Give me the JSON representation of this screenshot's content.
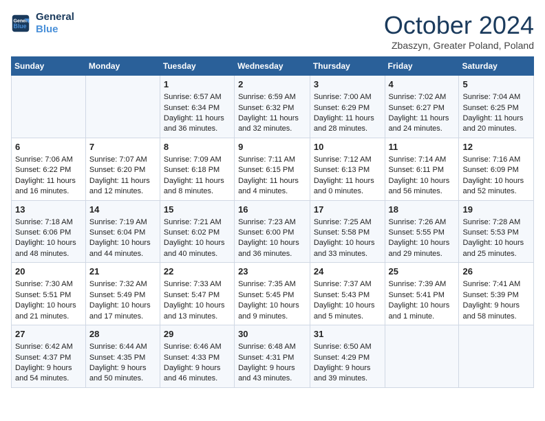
{
  "header": {
    "logo_line1": "General",
    "logo_line2": "Blue",
    "month_title": "October 2024",
    "subtitle": "Zbaszyn, Greater Poland, Poland"
  },
  "days_of_week": [
    "Sunday",
    "Monday",
    "Tuesday",
    "Wednesday",
    "Thursday",
    "Friday",
    "Saturday"
  ],
  "weeks": [
    [
      {
        "day": "",
        "sunrise": "",
        "sunset": "",
        "daylight": ""
      },
      {
        "day": "",
        "sunrise": "",
        "sunset": "",
        "daylight": ""
      },
      {
        "day": "1",
        "sunrise": "Sunrise: 6:57 AM",
        "sunset": "Sunset: 6:34 PM",
        "daylight": "Daylight: 11 hours and 36 minutes."
      },
      {
        "day": "2",
        "sunrise": "Sunrise: 6:59 AM",
        "sunset": "Sunset: 6:32 PM",
        "daylight": "Daylight: 11 hours and 32 minutes."
      },
      {
        "day": "3",
        "sunrise": "Sunrise: 7:00 AM",
        "sunset": "Sunset: 6:29 PM",
        "daylight": "Daylight: 11 hours and 28 minutes."
      },
      {
        "day": "4",
        "sunrise": "Sunrise: 7:02 AM",
        "sunset": "Sunset: 6:27 PM",
        "daylight": "Daylight: 11 hours and 24 minutes."
      },
      {
        "day": "5",
        "sunrise": "Sunrise: 7:04 AM",
        "sunset": "Sunset: 6:25 PM",
        "daylight": "Daylight: 11 hours and 20 minutes."
      }
    ],
    [
      {
        "day": "6",
        "sunrise": "Sunrise: 7:06 AM",
        "sunset": "Sunset: 6:22 PM",
        "daylight": "Daylight: 11 hours and 16 minutes."
      },
      {
        "day": "7",
        "sunrise": "Sunrise: 7:07 AM",
        "sunset": "Sunset: 6:20 PM",
        "daylight": "Daylight: 11 hours and 12 minutes."
      },
      {
        "day": "8",
        "sunrise": "Sunrise: 7:09 AM",
        "sunset": "Sunset: 6:18 PM",
        "daylight": "Daylight: 11 hours and 8 minutes."
      },
      {
        "day": "9",
        "sunrise": "Sunrise: 7:11 AM",
        "sunset": "Sunset: 6:15 PM",
        "daylight": "Daylight: 11 hours and 4 minutes."
      },
      {
        "day": "10",
        "sunrise": "Sunrise: 7:12 AM",
        "sunset": "Sunset: 6:13 PM",
        "daylight": "Daylight: 11 hours and 0 minutes."
      },
      {
        "day": "11",
        "sunrise": "Sunrise: 7:14 AM",
        "sunset": "Sunset: 6:11 PM",
        "daylight": "Daylight: 10 hours and 56 minutes."
      },
      {
        "day": "12",
        "sunrise": "Sunrise: 7:16 AM",
        "sunset": "Sunset: 6:09 PM",
        "daylight": "Daylight: 10 hours and 52 minutes."
      }
    ],
    [
      {
        "day": "13",
        "sunrise": "Sunrise: 7:18 AM",
        "sunset": "Sunset: 6:06 PM",
        "daylight": "Daylight: 10 hours and 48 minutes."
      },
      {
        "day": "14",
        "sunrise": "Sunrise: 7:19 AM",
        "sunset": "Sunset: 6:04 PM",
        "daylight": "Daylight: 10 hours and 44 minutes."
      },
      {
        "day": "15",
        "sunrise": "Sunrise: 7:21 AM",
        "sunset": "Sunset: 6:02 PM",
        "daylight": "Daylight: 10 hours and 40 minutes."
      },
      {
        "day": "16",
        "sunrise": "Sunrise: 7:23 AM",
        "sunset": "Sunset: 6:00 PM",
        "daylight": "Daylight: 10 hours and 36 minutes."
      },
      {
        "day": "17",
        "sunrise": "Sunrise: 7:25 AM",
        "sunset": "Sunset: 5:58 PM",
        "daylight": "Daylight: 10 hours and 33 minutes."
      },
      {
        "day": "18",
        "sunrise": "Sunrise: 7:26 AM",
        "sunset": "Sunset: 5:55 PM",
        "daylight": "Daylight: 10 hours and 29 minutes."
      },
      {
        "day": "19",
        "sunrise": "Sunrise: 7:28 AM",
        "sunset": "Sunset: 5:53 PM",
        "daylight": "Daylight: 10 hours and 25 minutes."
      }
    ],
    [
      {
        "day": "20",
        "sunrise": "Sunrise: 7:30 AM",
        "sunset": "Sunset: 5:51 PM",
        "daylight": "Daylight: 10 hours and 21 minutes."
      },
      {
        "day": "21",
        "sunrise": "Sunrise: 7:32 AM",
        "sunset": "Sunset: 5:49 PM",
        "daylight": "Daylight: 10 hours and 17 minutes."
      },
      {
        "day": "22",
        "sunrise": "Sunrise: 7:33 AM",
        "sunset": "Sunset: 5:47 PM",
        "daylight": "Daylight: 10 hours and 13 minutes."
      },
      {
        "day": "23",
        "sunrise": "Sunrise: 7:35 AM",
        "sunset": "Sunset: 5:45 PM",
        "daylight": "Daylight: 10 hours and 9 minutes."
      },
      {
        "day": "24",
        "sunrise": "Sunrise: 7:37 AM",
        "sunset": "Sunset: 5:43 PM",
        "daylight": "Daylight: 10 hours and 5 minutes."
      },
      {
        "day": "25",
        "sunrise": "Sunrise: 7:39 AM",
        "sunset": "Sunset: 5:41 PM",
        "daylight": "Daylight: 10 hours and 1 minute."
      },
      {
        "day": "26",
        "sunrise": "Sunrise: 7:41 AM",
        "sunset": "Sunset: 5:39 PM",
        "daylight": "Daylight: 9 hours and 58 minutes."
      }
    ],
    [
      {
        "day": "27",
        "sunrise": "Sunrise: 6:42 AM",
        "sunset": "Sunset: 4:37 PM",
        "daylight": "Daylight: 9 hours and 54 minutes."
      },
      {
        "day": "28",
        "sunrise": "Sunrise: 6:44 AM",
        "sunset": "Sunset: 4:35 PM",
        "daylight": "Daylight: 9 hours and 50 minutes."
      },
      {
        "day": "29",
        "sunrise": "Sunrise: 6:46 AM",
        "sunset": "Sunset: 4:33 PM",
        "daylight": "Daylight: 9 hours and 46 minutes."
      },
      {
        "day": "30",
        "sunrise": "Sunrise: 6:48 AM",
        "sunset": "Sunset: 4:31 PM",
        "daylight": "Daylight: 9 hours and 43 minutes."
      },
      {
        "day": "31",
        "sunrise": "Sunrise: 6:50 AM",
        "sunset": "Sunset: 4:29 PM",
        "daylight": "Daylight: 9 hours and 39 minutes."
      },
      {
        "day": "",
        "sunrise": "",
        "sunset": "",
        "daylight": ""
      },
      {
        "day": "",
        "sunrise": "",
        "sunset": "",
        "daylight": ""
      }
    ]
  ]
}
